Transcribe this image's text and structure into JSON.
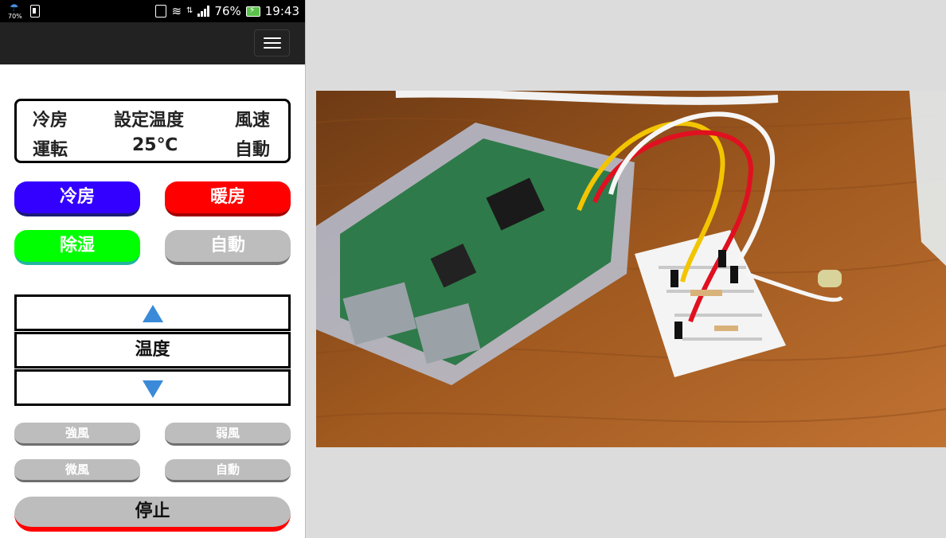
{
  "status_bar": {
    "weather_percent": "70%",
    "battery_percent": "76%",
    "time": "19:43"
  },
  "status_panel": {
    "mode_label": "冷房",
    "setpoint_label": "設定温度",
    "fan_label": "風速",
    "mode_value": "運転",
    "setpoint_value": "25℃",
    "fan_value": "自動"
  },
  "mode_buttons": {
    "cool": "冷房",
    "heat": "暖房",
    "dehumidify": "除湿",
    "auto": "自動"
  },
  "temperature": {
    "label": "温度"
  },
  "fan_buttons": {
    "strong": "強風",
    "weak": "弱風",
    "gentle": "微風",
    "auto": "自動"
  },
  "stop_button": "停止",
  "colors": {
    "cool": "#3300ff",
    "heat": "#ff0000",
    "dehumidify": "#00ff00",
    "auto": "#bdbdbd",
    "arrow": "#3a8ad9",
    "navbar": "#222222"
  },
  "icons": {
    "menu": "hamburger-menu-icon",
    "increase": "triangle-up-icon",
    "decrease": "triangle-down-icon"
  }
}
